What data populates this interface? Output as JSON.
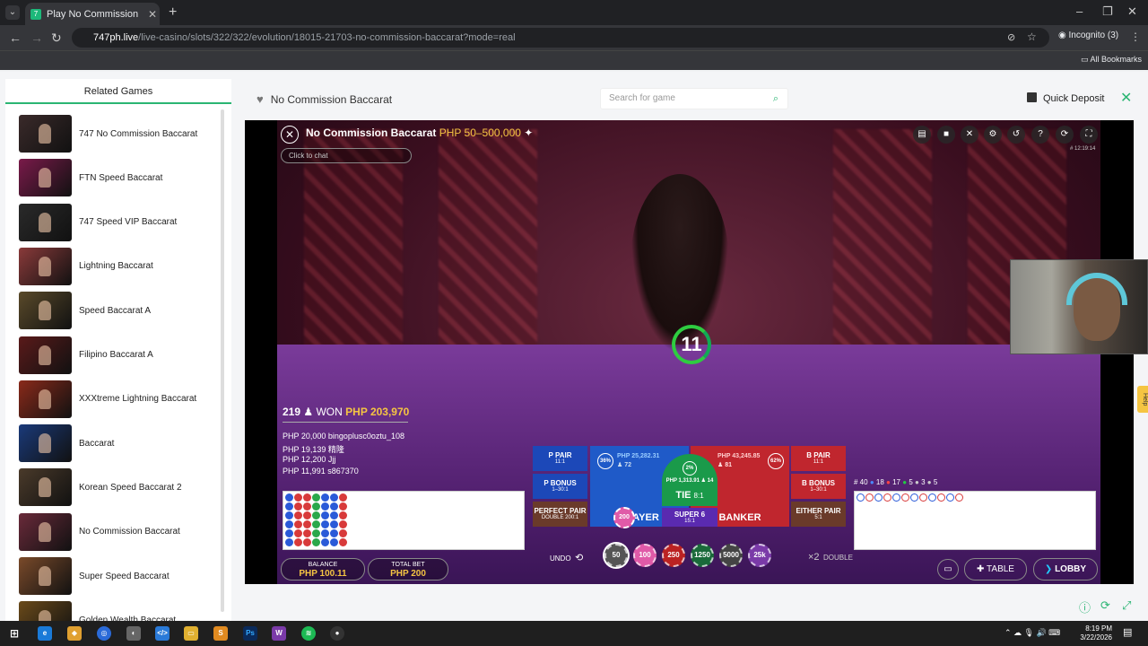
{
  "browser": {
    "tab_title": "Play No Commission Baccarat S",
    "url_host": "747ph.live",
    "url_path": "/live-casino/slots/322/322/evolution/18015-21703-no-commission-baccarat?mode=real",
    "incognito": "Incognito (3)",
    "all_bookmarks": "All Bookmarks"
  },
  "sidebar": {
    "title": "Related Games",
    "games": [
      {
        "label": "747 No Commission Baccarat",
        "color": "#3a2a2a"
      },
      {
        "label": "FTN Speed Baccarat",
        "color": "#7a1a4a"
      },
      {
        "label": "747 Speed VIP Baccarat",
        "color": "#2a2a2a"
      },
      {
        "label": "Lightning Baccarat",
        "color": "#8a3a3a"
      },
      {
        "label": "Speed Baccarat A",
        "color": "#5a4a2a"
      },
      {
        "label": "Filipino Baccarat A",
        "color": "#5a1a1a"
      },
      {
        "label": "XXXtreme Lightning Baccarat",
        "color": "#8a2a1a"
      },
      {
        "label": "Baccarat",
        "color": "#1a3a7a"
      },
      {
        "label": "Korean Speed Baccarat 2",
        "color": "#4a3a2a"
      },
      {
        "label": "No Commission Baccarat",
        "color": "#6a2a3a"
      },
      {
        "label": "Super Speed Baccarat",
        "color": "#7a4a2a"
      },
      {
        "label": "Golden Wealth Baccarat",
        "color": "#6a4a1a"
      }
    ]
  },
  "header": {
    "game_title": "No Commission Baccarat",
    "search_placeholder": "Search for game",
    "quick_deposit": "Quick Deposit"
  },
  "game": {
    "title": "No Commission Baccarat",
    "limits": "PHP 50–500,000",
    "chat_placeholder": "Click to chat",
    "clock": "# 12:19:14",
    "timer": "11",
    "winners_count": "219",
    "won_label": "WON",
    "won_amount": "PHP 203,970",
    "winners": [
      {
        "amount": "PHP 20,000",
        "name": "bingoplusc0oztu_108"
      },
      {
        "amount": "PHP 19,139",
        "name": "精隆"
      },
      {
        "amount": "PHP 12,200",
        "name": "Jjj"
      },
      {
        "amount": "PHP 11,991",
        "name": "s867370"
      }
    ],
    "bets": {
      "p_pair": "P PAIR",
      "p_pair_odds": "11:1",
      "p_bonus": "P BONUS",
      "p_bonus_odds": "1–30:1",
      "perfect_pair": "PERFECT PAIR",
      "perfect_pair_odds": "DOUBLE 200:1",
      "player": "PLAYER",
      "player_total": "PHP 25,282.31",
      "player_count": "72",
      "player_pct": "36%",
      "tie": "TIE",
      "tie_odds": "8:1",
      "tie_total": "PHP 1,313.91",
      "tie_count": "14",
      "tie_pct": "2%",
      "super6": "SUPER 6",
      "super6_odds": "15:1",
      "banker": "BANKER",
      "banker_total": "PHP 43,245.85",
      "banker_count": "81",
      "banker_pct": "62%",
      "b_pair": "B PAIR",
      "b_pair_odds": "11:1",
      "b_bonus": "B BONUS",
      "b_bonus_odds": "1–30:1",
      "either_pair": "EITHER PAIR",
      "either_pair_odds": "5:1",
      "player_chip": "200"
    },
    "road_stats": {
      "round": "# 40",
      "p": "18",
      "b": "17",
      "t": "5",
      "pp": "3",
      "bp": "5"
    },
    "balance_label": "BALANCE",
    "balance_value": "PHP 100.11",
    "total_bet_label": "TOTAL BET",
    "total_bet_value": "PHP 200",
    "undo": "UNDO",
    "double": "DOUBLE",
    "double_x": "×2",
    "chips": [
      {
        "value": "50",
        "color": "#555"
      },
      {
        "value": "100",
        "color": "#e05aa8"
      },
      {
        "value": "250",
        "color": "#b22"
      },
      {
        "value": "1250",
        "color": "#1a6a3a"
      },
      {
        "value": "5000",
        "color": "#444"
      },
      {
        "value": "25k",
        "color": "#7a3aa8"
      }
    ],
    "table_btn": "TABLE",
    "lobby_btn": "LOBBY"
  },
  "help_label": "Help",
  "taskbar": {
    "time": "8:19 PM",
    "date": "3/22/2026"
  }
}
